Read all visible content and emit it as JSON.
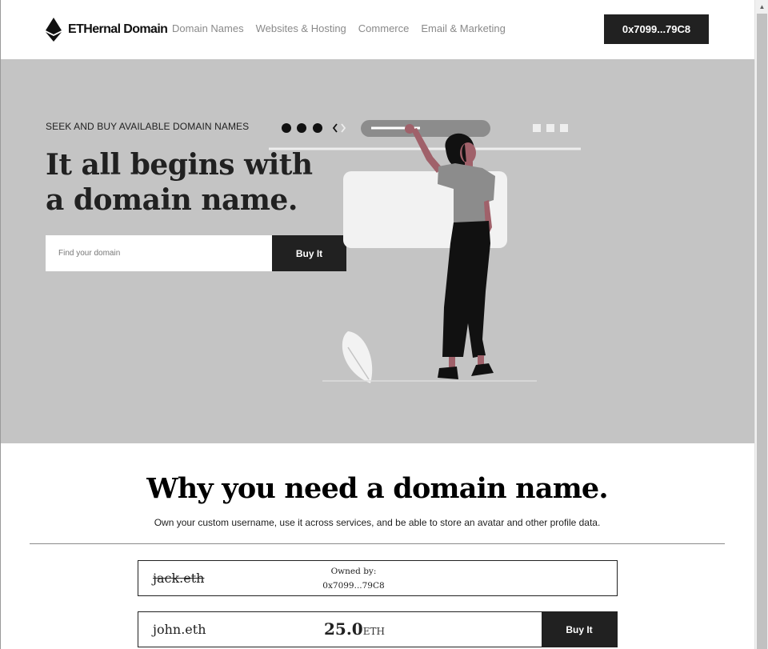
{
  "header": {
    "brand": "ETHernal Domain",
    "nav": [
      "Domain Names",
      "Websites & Hosting",
      "Commerce",
      "Email & Marketing"
    ],
    "wallet": "0x7099...79C8"
  },
  "hero": {
    "eyebrow": "SEEK AND BUY AVAILABLE DOMAIN NAMES",
    "title": "It all begins with a domain name.",
    "search_placeholder": "Find your domain",
    "search_value": "",
    "buy_label": "Buy It",
    "background_color": "#c4c4c4"
  },
  "why": {
    "title": "Why you need a domain name.",
    "subtitle": "Own your custom username, use it across services, and be able to store an avatar and other profile data."
  },
  "domains": [
    {
      "name": "jack.eth",
      "status": "owned",
      "owned_label": "Owned by:",
      "owner": "0x7099...79C8"
    },
    {
      "name": "john.eth",
      "status": "available",
      "price": "25.0",
      "unit": "ETH",
      "buy_label": "Buy It"
    }
  ],
  "colors": {
    "accent": "#212121",
    "illustration_skin": "#a0616a",
    "nav_text": "#8a8a8a"
  }
}
